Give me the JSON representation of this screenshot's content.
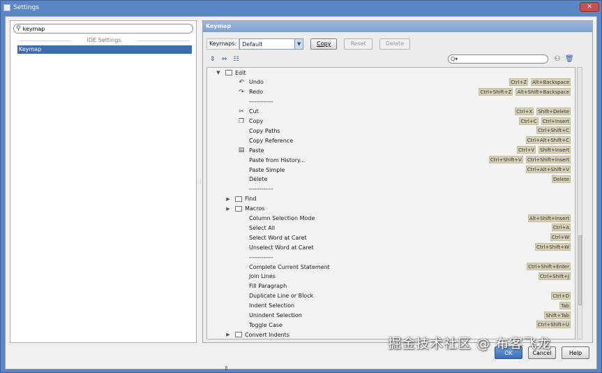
{
  "window": {
    "title": "Settings"
  },
  "left": {
    "search_value": "keymap",
    "section_header": "IDE Settings",
    "selected_item": "Keymap"
  },
  "right": {
    "header": "Keymap",
    "keymaps_label": "Keymaps:",
    "keymaps_value": "Default",
    "copy_label": "Copy",
    "reset_label": "Reset",
    "delete_label": "Delete",
    "filter_placeholder": "Q▾"
  },
  "tree": [
    {
      "kind": "folder",
      "label": "Edit",
      "expanded": true,
      "depth": 1,
      "shortcuts": []
    },
    {
      "kind": "action",
      "label": "Undo",
      "icon": "undo-icon",
      "glyph": "↶",
      "shortcuts": [
        "Ctrl+Z",
        "Alt+Backspace"
      ]
    },
    {
      "kind": "action",
      "label": "Redo",
      "icon": "redo-icon",
      "glyph": "↷",
      "shortcuts": [
        "Ctrl+Shift+Z",
        "Alt+Shift+Backspace"
      ]
    },
    {
      "kind": "separator",
      "label": "------------",
      "shortcuts": []
    },
    {
      "kind": "action",
      "label": "Cut",
      "icon": "scissors-icon",
      "glyph": "✂",
      "shortcuts": [
        "Ctrl+X",
        "Shift+Delete"
      ]
    },
    {
      "kind": "action",
      "label": "Copy",
      "icon": "copy-icon",
      "glyph": "❐",
      "shortcuts": [
        "Ctrl+C",
        "Ctrl+Insert"
      ]
    },
    {
      "kind": "action",
      "label": "Copy Paths",
      "shortcuts": [
        "Ctrl+Shift+C"
      ]
    },
    {
      "kind": "action",
      "label": "Copy Reference",
      "shortcuts": [
        "Ctrl+Alt+Shift+C"
      ]
    },
    {
      "kind": "action",
      "label": "Paste",
      "icon": "paste-icon",
      "glyph": "▤",
      "shortcuts": [
        "Ctrl+V",
        "Shift+Insert"
      ]
    },
    {
      "kind": "action",
      "label": "Paste from History...",
      "shortcuts": [
        "Ctrl+Shift+V",
        "Ctrl+Shift+Insert"
      ]
    },
    {
      "kind": "action",
      "label": "Paste Simple",
      "shortcuts": [
        "Ctrl+Alt+Shift+V"
      ]
    },
    {
      "kind": "action",
      "label": "Delete",
      "shortcuts": [
        "Delete"
      ]
    },
    {
      "kind": "separator",
      "label": "------------",
      "shortcuts": []
    },
    {
      "kind": "folder",
      "label": "Find",
      "expanded": false,
      "depth": 2,
      "shortcuts": []
    },
    {
      "kind": "folder",
      "label": "Macros",
      "expanded": false,
      "depth": 2,
      "shortcuts": []
    },
    {
      "kind": "action",
      "label": "Column Selection Mode",
      "shortcuts": [
        "Alt+Shift+Insert"
      ]
    },
    {
      "kind": "action",
      "label": "Select All",
      "shortcuts": [
        "Ctrl+A"
      ]
    },
    {
      "kind": "action",
      "label": "Select Word at Caret",
      "shortcuts": [
        "Ctrl+W"
      ]
    },
    {
      "kind": "action",
      "label": "Unselect Word at Caret",
      "shortcuts": [
        "Ctrl+Shift+W"
      ]
    },
    {
      "kind": "separator",
      "label": "------------",
      "shortcuts": []
    },
    {
      "kind": "action",
      "label": "Complete Current Statement",
      "shortcuts": [
        "Ctrl+Shift+Enter"
      ]
    },
    {
      "kind": "action",
      "label": "Join Lines",
      "shortcuts": [
        "Ctrl+Shift+J"
      ]
    },
    {
      "kind": "action",
      "label": "Fill Paragraph",
      "shortcuts": []
    },
    {
      "kind": "action",
      "label": "Duplicate Line or Block",
      "shortcuts": [
        "Ctrl+D"
      ]
    },
    {
      "kind": "action",
      "label": "Indent Selection",
      "shortcuts": [
        "Tab"
      ]
    },
    {
      "kind": "action",
      "label": "Unindent Selection",
      "shortcuts": [
        "Shift+Tab"
      ]
    },
    {
      "kind": "action",
      "label": "Toggle Case",
      "shortcuts": [
        "Ctrl+Shift+U"
      ]
    },
    {
      "kind": "folder",
      "label": "Convert Indents",
      "expanded": false,
      "depth": 2,
      "shortcuts": []
    }
  ],
  "buttons": {
    "ok": "OK",
    "cancel": "Cancel",
    "help": "Help"
  },
  "watermark": "掘金技术社区 @ 布客飞龙"
}
